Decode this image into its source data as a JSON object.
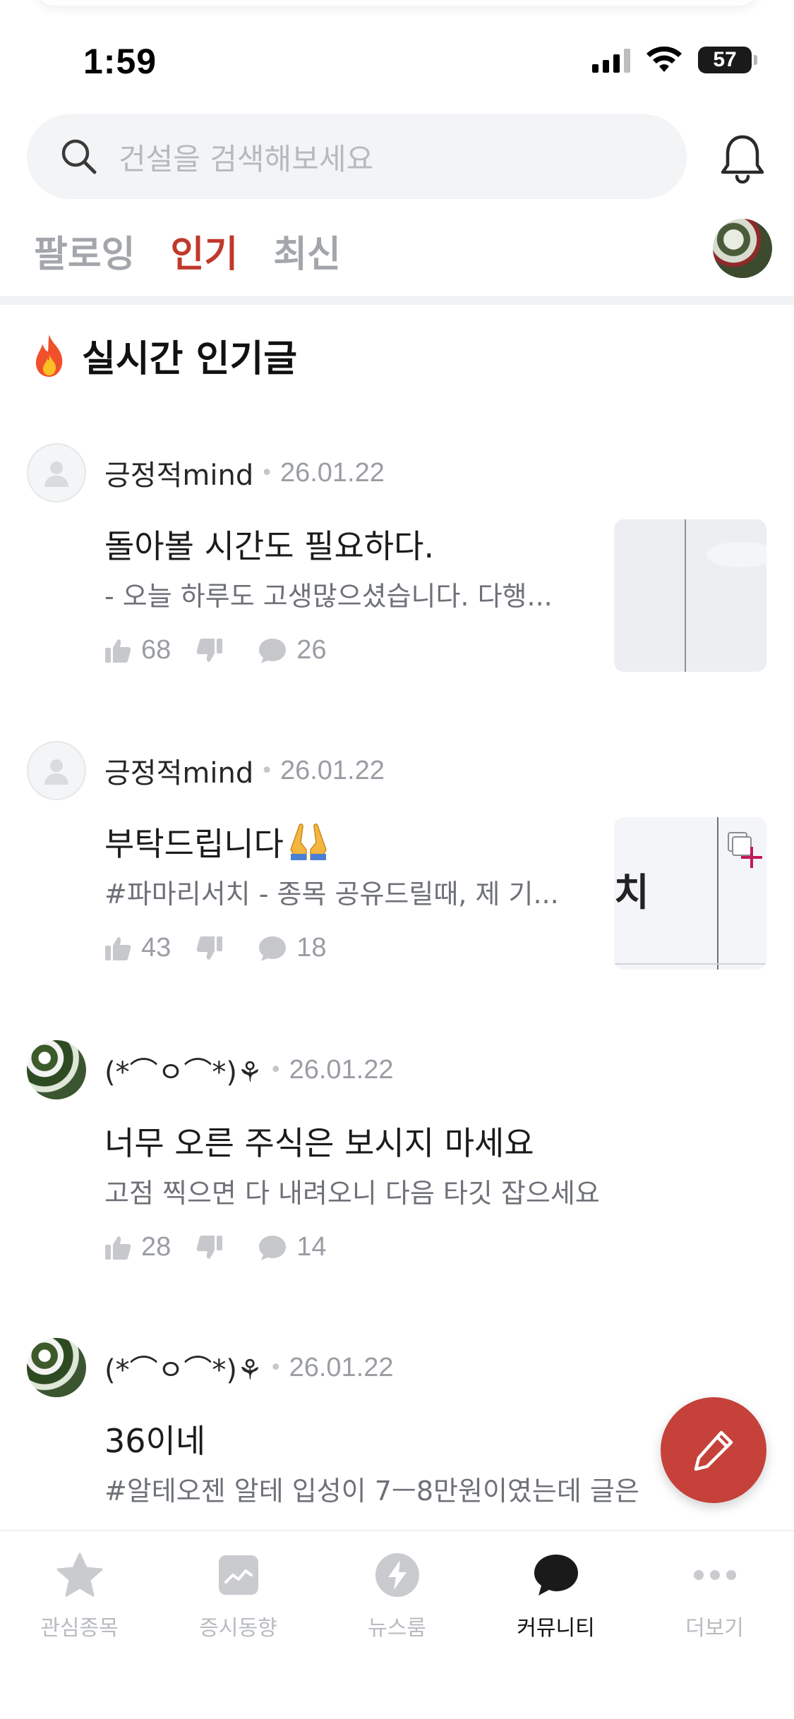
{
  "status_bar": {
    "time": "1:59",
    "battery": "57"
  },
  "search": {
    "placeholder": "건설을 검색해보세요"
  },
  "tabs": [
    {
      "label": "팔로잉",
      "active": false
    },
    {
      "label": "인기",
      "active": true
    },
    {
      "label": "최신",
      "active": false
    }
  ],
  "section": {
    "title": "실시간 인기글",
    "icon": "fire-icon"
  },
  "posts": [
    {
      "author": "긍정적mind",
      "date": "26.01.22",
      "title": "돌아볼 시간도 필요하다.",
      "snippet": "- 오늘 하루도 고생많으셨습니다. 다행...",
      "likes": "68",
      "comments": "26",
      "has_thumbnail": true
    },
    {
      "author": "긍정적mind",
      "date": "26.01.22",
      "title": "부탁드립니다",
      "title_emoji": "🙏🙏",
      "snippet": "#파마리서치 - 종목 공유드릴때, 제 기...",
      "likes": "43",
      "comments": "18",
      "has_thumbnail": true,
      "thumbnail_text": "치"
    },
    {
      "author": "(*⌒ㅇ⌒*)⚘",
      "date": "26.01.22",
      "title": "너무 오른 주식은 보시지 마세요",
      "snippet": "고점 찍으면 다 내려오니 다음 타깃 잡으세요",
      "likes": "28",
      "comments": "14",
      "has_thumbnail": false
    },
    {
      "author": "(*⌒ㅇ⌒*)⚘",
      "date": "26.01.22",
      "title": "36이네",
      "snippet": "#알테오젠 알테 입성이 7ㅡ8만원이였는데 글은",
      "has_thumbnail": false
    }
  ],
  "bottom_nav": [
    {
      "label": "관심종목",
      "icon": "star-icon",
      "active": false
    },
    {
      "label": "증시동향",
      "icon": "chart-icon",
      "active": false
    },
    {
      "label": "뉴스룸",
      "icon": "bolt-icon",
      "active": false
    },
    {
      "label": "커뮤니티",
      "icon": "chat-bubble-icon",
      "active": true
    },
    {
      "label": "더보기",
      "icon": "more-dots-icon",
      "active": false
    }
  ],
  "colors": {
    "accent": "#c0392b",
    "fab": "#c5413a",
    "muted": "#9a9da3"
  }
}
